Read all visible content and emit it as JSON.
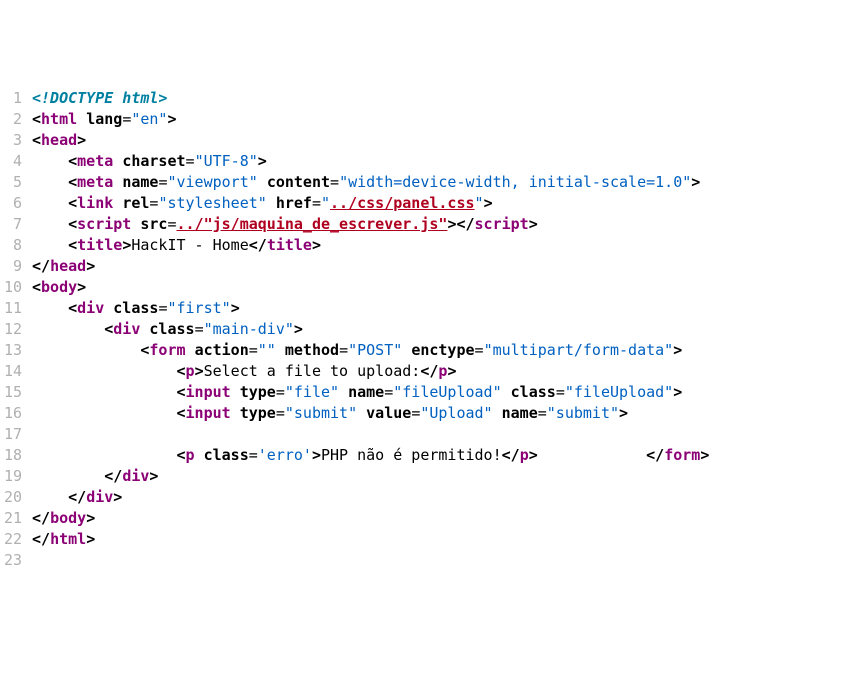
{
  "lines": [
    {
      "num": 1,
      "tokens": [
        {
          "c": "doctype",
          "t": "<!DOCTYPE html>"
        }
      ]
    },
    {
      "num": 2,
      "tokens": [
        {
          "c": "tag-punct",
          "t": "<"
        },
        {
          "c": "tag-name",
          "t": "html"
        },
        {
          "c": "text",
          "t": " "
        },
        {
          "c": "attr-name",
          "t": "lang"
        },
        {
          "c": "attr-eq",
          "t": "="
        },
        {
          "c": "attr-val",
          "t": "\"en\""
        },
        {
          "c": "tag-punct",
          "t": ">"
        }
      ]
    },
    {
      "num": 3,
      "tokens": [
        {
          "c": "tag-punct",
          "t": "<"
        },
        {
          "c": "tag-name",
          "t": "head"
        },
        {
          "c": "tag-punct",
          "t": ">"
        }
      ]
    },
    {
      "num": 4,
      "tokens": [
        {
          "c": "text",
          "t": "    "
        },
        {
          "c": "tag-punct",
          "t": "<"
        },
        {
          "c": "tag-name",
          "t": "meta"
        },
        {
          "c": "text",
          "t": " "
        },
        {
          "c": "attr-name",
          "t": "charset"
        },
        {
          "c": "attr-eq",
          "t": "="
        },
        {
          "c": "attr-val",
          "t": "\"UTF-8\""
        },
        {
          "c": "tag-punct",
          "t": ">"
        }
      ]
    },
    {
      "num": 5,
      "tokens": [
        {
          "c": "text",
          "t": "    "
        },
        {
          "c": "tag-punct",
          "t": "<"
        },
        {
          "c": "tag-name",
          "t": "meta"
        },
        {
          "c": "text",
          "t": " "
        },
        {
          "c": "attr-name",
          "t": "name"
        },
        {
          "c": "attr-eq",
          "t": "="
        },
        {
          "c": "attr-val",
          "t": "\"viewport\""
        },
        {
          "c": "text",
          "t": " "
        },
        {
          "c": "attr-name",
          "t": "content"
        },
        {
          "c": "attr-eq",
          "t": "="
        },
        {
          "c": "attr-val",
          "t": "\"width=device-width, initial-scale=1.0\""
        },
        {
          "c": "tag-punct",
          "t": ">"
        }
      ]
    },
    {
      "num": 6,
      "tokens": [
        {
          "c": "text",
          "t": "    "
        },
        {
          "c": "tag-punct",
          "t": "<"
        },
        {
          "c": "tag-name",
          "t": "link"
        },
        {
          "c": "text",
          "t": " "
        },
        {
          "c": "attr-name",
          "t": "rel"
        },
        {
          "c": "attr-eq",
          "t": "="
        },
        {
          "c": "attr-val",
          "t": "\"stylesheet\""
        },
        {
          "c": "text",
          "t": " "
        },
        {
          "c": "attr-name",
          "t": "href"
        },
        {
          "c": "attr-eq",
          "t": "="
        },
        {
          "c": "attr-val",
          "t": "\""
        },
        {
          "c": "err-link",
          "t": "../css/panel.css"
        },
        {
          "c": "attr-val",
          "t": "\""
        },
        {
          "c": "tag-punct",
          "t": ">"
        }
      ]
    },
    {
      "num": 7,
      "tokens": [
        {
          "c": "text",
          "t": "    "
        },
        {
          "c": "tag-punct",
          "t": "<"
        },
        {
          "c": "tag-name",
          "t": "script"
        },
        {
          "c": "text",
          "t": " "
        },
        {
          "c": "attr-name",
          "t": "src"
        },
        {
          "c": "attr-eq",
          "t": "="
        },
        {
          "c": "err-link",
          "t": "../\"js/maquina_de_escrever.js\""
        },
        {
          "c": "tag-punct",
          "t": "></"
        },
        {
          "c": "tag-name",
          "t": "script"
        },
        {
          "c": "tag-punct",
          "t": ">"
        }
      ]
    },
    {
      "num": 8,
      "tokens": [
        {
          "c": "text",
          "t": "    "
        },
        {
          "c": "tag-punct",
          "t": "<"
        },
        {
          "c": "tag-name",
          "t": "title"
        },
        {
          "c": "tag-punct",
          "t": ">"
        },
        {
          "c": "text",
          "t": "HackIT - Home"
        },
        {
          "c": "tag-punct",
          "t": "</"
        },
        {
          "c": "tag-name",
          "t": "title"
        },
        {
          "c": "tag-punct",
          "t": ">"
        }
      ]
    },
    {
      "num": 9,
      "tokens": [
        {
          "c": "tag-punct",
          "t": "</"
        },
        {
          "c": "tag-name",
          "t": "head"
        },
        {
          "c": "tag-punct",
          "t": ">"
        }
      ]
    },
    {
      "num": 10,
      "tokens": [
        {
          "c": "tag-punct",
          "t": "<"
        },
        {
          "c": "tag-name",
          "t": "body"
        },
        {
          "c": "tag-punct",
          "t": ">"
        }
      ]
    },
    {
      "num": 11,
      "tokens": [
        {
          "c": "text",
          "t": "    "
        },
        {
          "c": "tag-punct",
          "t": "<"
        },
        {
          "c": "tag-name",
          "t": "div"
        },
        {
          "c": "text",
          "t": " "
        },
        {
          "c": "attr-name",
          "t": "class"
        },
        {
          "c": "attr-eq",
          "t": "="
        },
        {
          "c": "attr-val",
          "t": "\"first\""
        },
        {
          "c": "tag-punct",
          "t": ">"
        }
      ]
    },
    {
      "num": 12,
      "tokens": [
        {
          "c": "text",
          "t": "        "
        },
        {
          "c": "tag-punct",
          "t": "<"
        },
        {
          "c": "tag-name",
          "t": "div"
        },
        {
          "c": "text",
          "t": " "
        },
        {
          "c": "attr-name",
          "t": "class"
        },
        {
          "c": "attr-eq",
          "t": "="
        },
        {
          "c": "attr-val",
          "t": "\"main-div\""
        },
        {
          "c": "tag-punct",
          "t": ">"
        }
      ]
    },
    {
      "num": 13,
      "tokens": [
        {
          "c": "text",
          "t": "            "
        },
        {
          "c": "tag-punct",
          "t": "<"
        },
        {
          "c": "tag-name",
          "t": "form"
        },
        {
          "c": "text",
          "t": " "
        },
        {
          "c": "attr-name",
          "t": "action"
        },
        {
          "c": "attr-eq",
          "t": "="
        },
        {
          "c": "attr-val",
          "t": "\"\""
        },
        {
          "c": "text",
          "t": " "
        },
        {
          "c": "attr-name",
          "t": "method"
        },
        {
          "c": "attr-eq",
          "t": "="
        },
        {
          "c": "attr-val",
          "t": "\"POST\""
        },
        {
          "c": "text",
          "t": " "
        },
        {
          "c": "attr-name",
          "t": "enctype"
        },
        {
          "c": "attr-eq",
          "t": "="
        },
        {
          "c": "attr-val",
          "t": "\"multipart/form-data\""
        },
        {
          "c": "tag-punct",
          "t": ">"
        }
      ]
    },
    {
      "num": 14,
      "tokens": [
        {
          "c": "text",
          "t": "                "
        },
        {
          "c": "tag-punct",
          "t": "<"
        },
        {
          "c": "tag-name",
          "t": "p"
        },
        {
          "c": "tag-punct",
          "t": ">"
        },
        {
          "c": "text",
          "t": "Select a file to upload:"
        },
        {
          "c": "tag-punct",
          "t": "</"
        },
        {
          "c": "tag-name",
          "t": "p"
        },
        {
          "c": "tag-punct",
          "t": ">"
        }
      ]
    },
    {
      "num": 15,
      "tokens": [
        {
          "c": "text",
          "t": "                "
        },
        {
          "c": "tag-punct",
          "t": "<"
        },
        {
          "c": "tag-name",
          "t": "input"
        },
        {
          "c": "text",
          "t": " "
        },
        {
          "c": "attr-name",
          "t": "type"
        },
        {
          "c": "attr-eq",
          "t": "="
        },
        {
          "c": "attr-val",
          "t": "\"file\""
        },
        {
          "c": "text",
          "t": " "
        },
        {
          "c": "attr-name",
          "t": "name"
        },
        {
          "c": "attr-eq",
          "t": "="
        },
        {
          "c": "attr-val",
          "t": "\"fileUpload\""
        },
        {
          "c": "text",
          "t": " "
        },
        {
          "c": "attr-name",
          "t": "class"
        },
        {
          "c": "attr-eq",
          "t": "="
        },
        {
          "c": "attr-val",
          "t": "\"fileUpload\""
        },
        {
          "c": "tag-punct",
          "t": ">"
        }
      ]
    },
    {
      "num": 16,
      "tokens": [
        {
          "c": "text",
          "t": "                "
        },
        {
          "c": "tag-punct",
          "t": "<"
        },
        {
          "c": "tag-name",
          "t": "input"
        },
        {
          "c": "text",
          "t": " "
        },
        {
          "c": "attr-name",
          "t": "type"
        },
        {
          "c": "attr-eq",
          "t": "="
        },
        {
          "c": "attr-val",
          "t": "\"submit\""
        },
        {
          "c": "text",
          "t": " "
        },
        {
          "c": "attr-name",
          "t": "value"
        },
        {
          "c": "attr-eq",
          "t": "="
        },
        {
          "c": "attr-val",
          "t": "\"Upload\""
        },
        {
          "c": "text",
          "t": " "
        },
        {
          "c": "attr-name",
          "t": "name"
        },
        {
          "c": "attr-eq",
          "t": "="
        },
        {
          "c": "attr-val",
          "t": "\"submit\""
        },
        {
          "c": "tag-punct",
          "t": ">"
        }
      ]
    },
    {
      "num": 17,
      "tokens": [
        {
          "c": "text",
          "t": "                "
        }
      ]
    },
    {
      "num": 18,
      "tokens": [
        {
          "c": "text",
          "t": "                "
        },
        {
          "c": "tag-punct",
          "t": "<"
        },
        {
          "c": "tag-name",
          "t": "p"
        },
        {
          "c": "text",
          "t": " "
        },
        {
          "c": "attr-name",
          "t": "class"
        },
        {
          "c": "attr-eq",
          "t": "="
        },
        {
          "c": "attr-val",
          "t": "'erro'"
        },
        {
          "c": "tag-punct",
          "t": ">"
        },
        {
          "c": "text",
          "t": "PHP não é permitido!"
        },
        {
          "c": "tag-punct",
          "t": "</"
        },
        {
          "c": "tag-name",
          "t": "p"
        },
        {
          "c": "tag-punct",
          "t": ">"
        },
        {
          "c": "text",
          "t": "            "
        },
        {
          "c": "tag-punct",
          "t": "</"
        },
        {
          "c": "tag-name",
          "t": "form"
        },
        {
          "c": "tag-punct",
          "t": ">"
        }
      ]
    },
    {
      "num": 19,
      "tokens": [
        {
          "c": "text",
          "t": "        "
        },
        {
          "c": "tag-punct",
          "t": "</"
        },
        {
          "c": "tag-name",
          "t": "div"
        },
        {
          "c": "tag-punct",
          "t": ">"
        }
      ]
    },
    {
      "num": 20,
      "tokens": [
        {
          "c": "text",
          "t": "    "
        },
        {
          "c": "tag-punct",
          "t": "</"
        },
        {
          "c": "tag-name",
          "t": "div"
        },
        {
          "c": "tag-punct",
          "t": ">"
        }
      ]
    },
    {
      "num": 21,
      "tokens": [
        {
          "c": "tag-punct",
          "t": "</"
        },
        {
          "c": "tag-name",
          "t": "body"
        },
        {
          "c": "tag-punct",
          "t": ">"
        }
      ]
    },
    {
      "num": 22,
      "tokens": [
        {
          "c": "tag-punct",
          "t": "</"
        },
        {
          "c": "tag-name",
          "t": "html"
        },
        {
          "c": "tag-punct",
          "t": ">"
        }
      ]
    },
    {
      "num": 23,
      "tokens": [
        {
          "c": "text",
          "t": " "
        }
      ]
    }
  ]
}
